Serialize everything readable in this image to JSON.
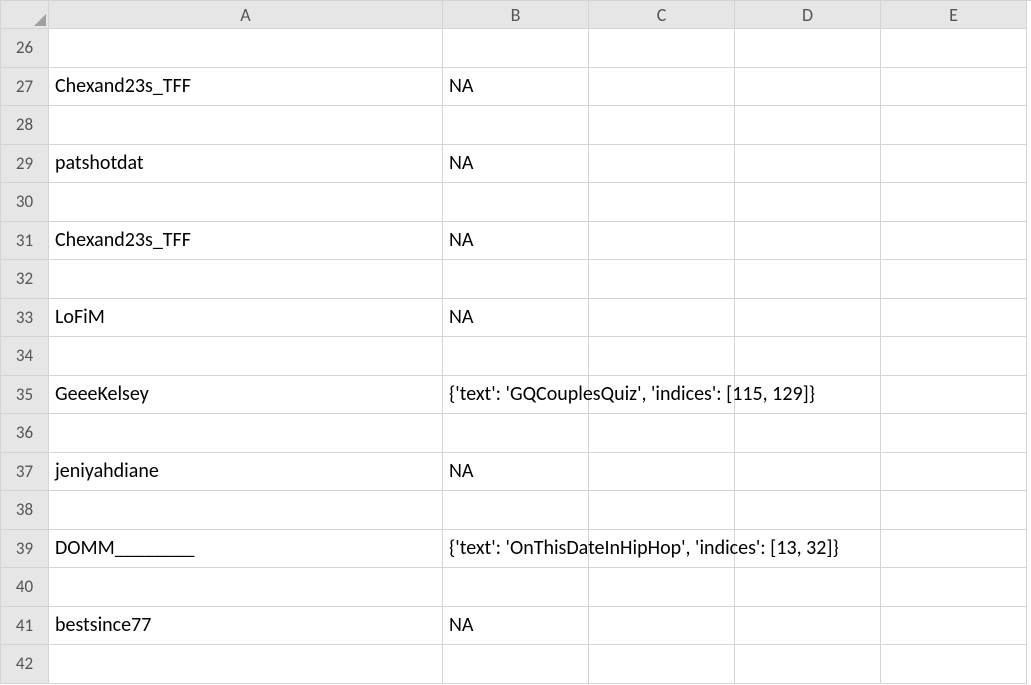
{
  "columns": [
    "A",
    "B",
    "C",
    "D",
    "E"
  ],
  "startRow": 26,
  "endRow": 42,
  "rows": [
    {
      "num": 26,
      "A": "",
      "B": ""
    },
    {
      "num": 27,
      "A": "Chexand23s_TFF",
      "B": "NA"
    },
    {
      "num": 28,
      "A": "",
      "B": ""
    },
    {
      "num": 29,
      "A": "patshotdat",
      "B": "NA"
    },
    {
      "num": 30,
      "A": "",
      "B": ""
    },
    {
      "num": 31,
      "A": "Chexand23s_TFF",
      "B": "NA"
    },
    {
      "num": 32,
      "A": "",
      "B": ""
    },
    {
      "num": 33,
      "A": "LoFiM",
      "B": "NA"
    },
    {
      "num": 34,
      "A": "",
      "B": ""
    },
    {
      "num": 35,
      "A": "GeeeKelsey",
      "B": "{'text': 'GQCouplesQuiz', 'indices': [115, 129]}"
    },
    {
      "num": 36,
      "A": "",
      "B": ""
    },
    {
      "num": 37,
      "A": "jeniyahdiane",
      "B": "NA"
    },
    {
      "num": 38,
      "A": "",
      "B": ""
    },
    {
      "num": 39,
      "A": "DOMM________",
      "B": "{'text': 'OnThisDateInHipHop', 'indices': [13, 32]}"
    },
    {
      "num": 40,
      "A": "",
      "B": ""
    },
    {
      "num": 41,
      "A": "bestsince77",
      "B": "NA"
    },
    {
      "num": 42,
      "A": "",
      "B": ""
    }
  ]
}
